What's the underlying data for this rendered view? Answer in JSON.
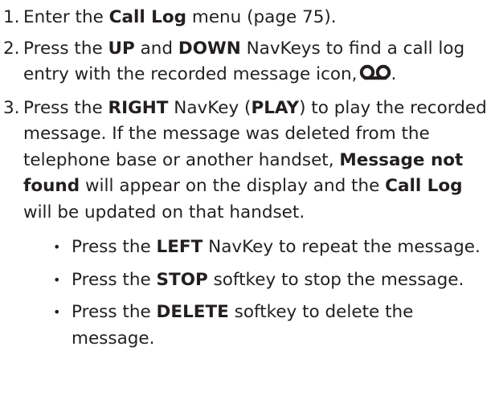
{
  "steps": [
    {
      "number": "1.",
      "parts": [
        "Enter the ",
        "Call Log",
        " menu (page 75)."
      ]
    },
    {
      "number": "2.",
      "parts": [
        "Press the ",
        "UP",
        " and ",
        "DOWN",
        " NavKeys to find a call log entry with the recorded message icon,",
        "."
      ],
      "icon": "voicemail-icon"
    },
    {
      "number": "3.",
      "parts": [
        "Press the ",
        "RIGHT",
        " NavKey (",
        "PLAY",
        ") to play the recorded message. If the message was deleted from the telephone base or another handset, ",
        "Message not found",
        " will appear on the display and the ",
        "Call Log",
        " will be updated on that handset."
      ],
      "bullets": [
        {
          "parts": [
            "Press the ",
            "LEFT",
            " NavKey to repeat the message."
          ]
        },
        {
          "parts": [
            "Press the ",
            "STOP",
            " softkey to stop the message."
          ]
        },
        {
          "parts": [
            "Press the ",
            "DELETE",
            " softkey to delete the message."
          ]
        }
      ]
    }
  ],
  "bullet_char": "•"
}
